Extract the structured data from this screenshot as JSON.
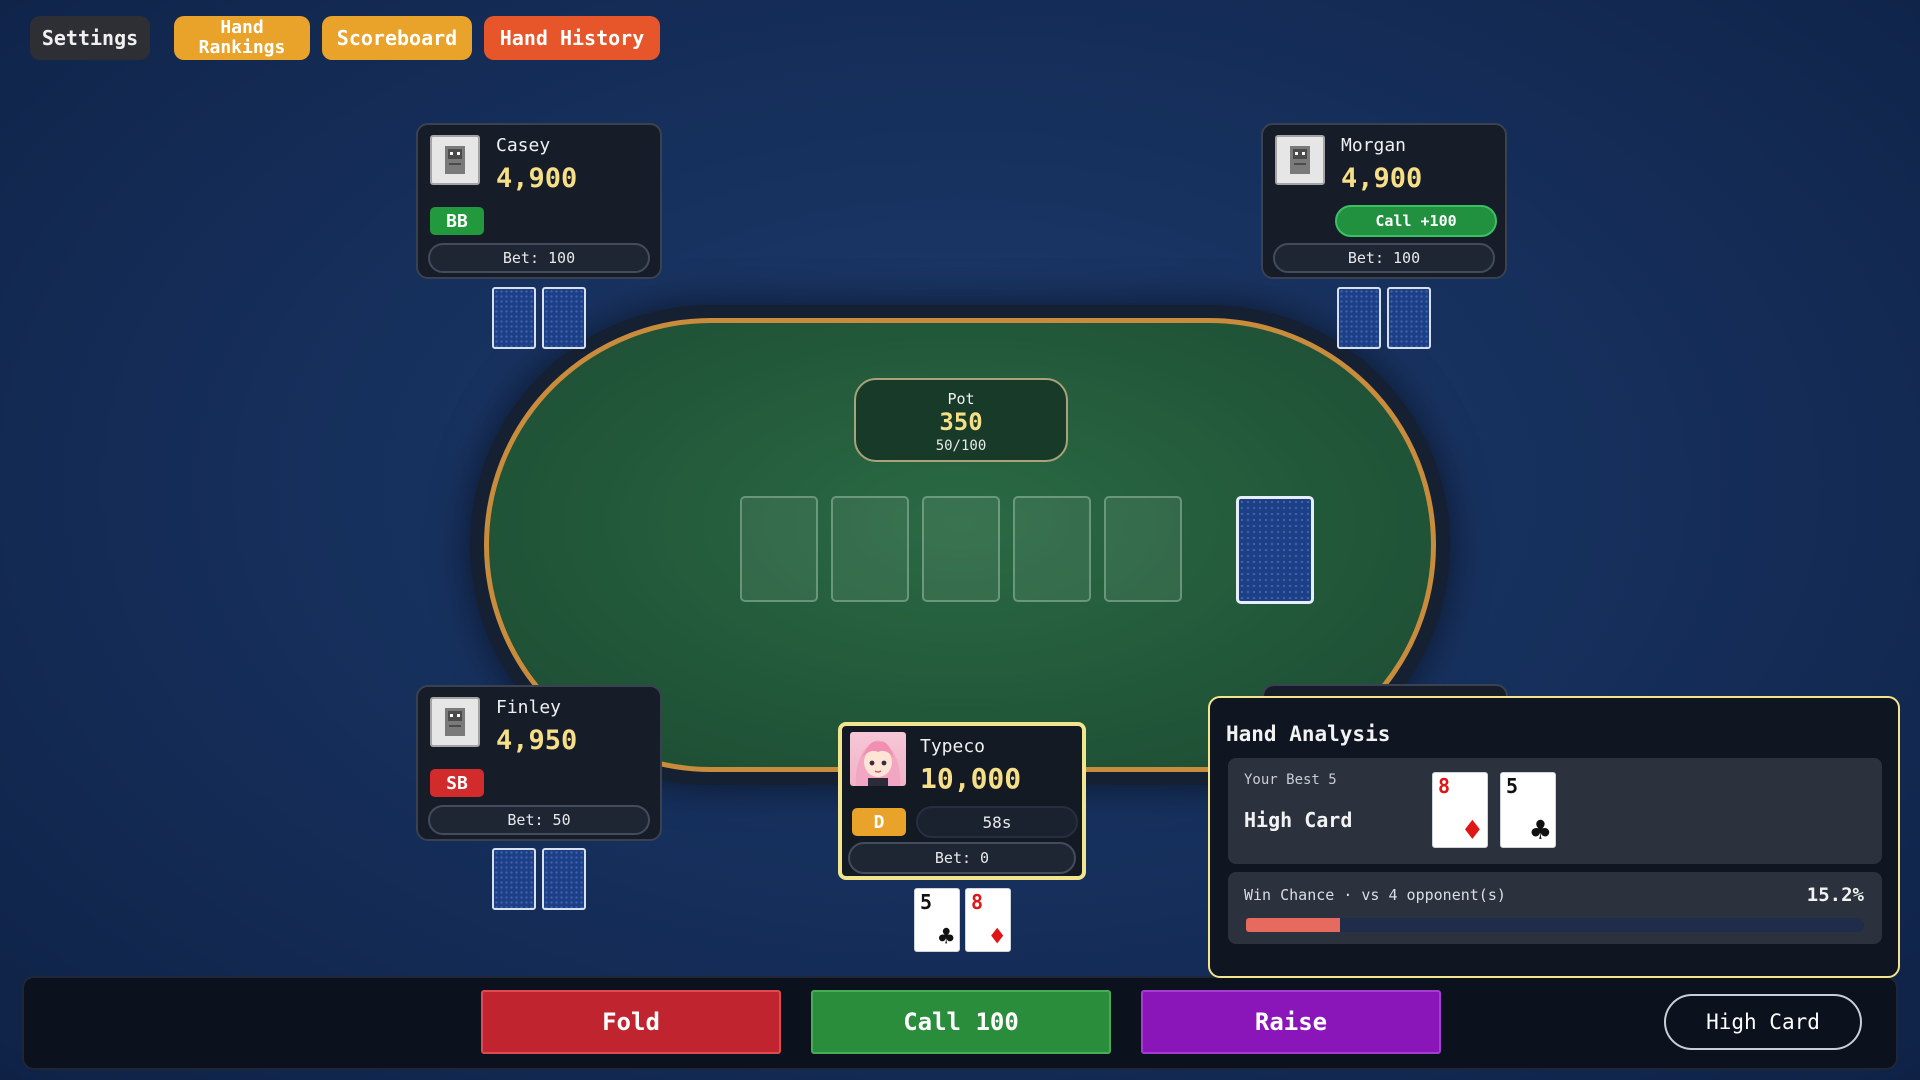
{
  "top_bar": {
    "settings": "Settings",
    "hand_rankings": "Hand Rankings",
    "scoreboard": "Scoreboard",
    "hand_history": "Hand History"
  },
  "pot": {
    "label": "Pot",
    "amount": "350",
    "blinds": "50/100"
  },
  "players": {
    "casey": {
      "name": "Casey",
      "chips": "4,900",
      "badge": "BB",
      "bet": "Bet: 100"
    },
    "morgan": {
      "name": "Morgan",
      "chips": "4,900",
      "action": "Call +100",
      "bet": "Bet: 100"
    },
    "finley": {
      "name": "Finley",
      "chips": "4,950",
      "badge": "SB",
      "bet": "Bet: 50"
    }
  },
  "hero": {
    "name": "Typeco",
    "chips": "10,000",
    "badge": "D",
    "timer": "58s",
    "bet": "Bet: 0",
    "cards": [
      {
        "rank": "5",
        "suit": "♣",
        "color": "#111111"
      },
      {
        "rank": "8",
        "suit": "♦",
        "color": "#e01515"
      }
    ]
  },
  "actions": {
    "fold": "Fold",
    "call": "Call 100",
    "raise": "Raise",
    "hand_strength": "High Card"
  },
  "analysis": {
    "title": "Hand Analysis",
    "best5_label": "Your Best 5",
    "best5_hand": "High Card",
    "best5_cards": [
      {
        "rank": "8",
        "suit": "♦",
        "color": "#e01515"
      },
      {
        "rank": "5",
        "suit": "♣",
        "color": "#111111"
      }
    ],
    "win_label": "Win Chance · vs 4 opponent(s)",
    "win_value": "15.2%",
    "win_fraction": 0.152
  },
  "colors": {
    "gold": "#f6df86",
    "fold": "#c0242f",
    "call": "#2a8d3b",
    "raise": "#8a16b9",
    "accent_orange": "#e9a22a"
  }
}
